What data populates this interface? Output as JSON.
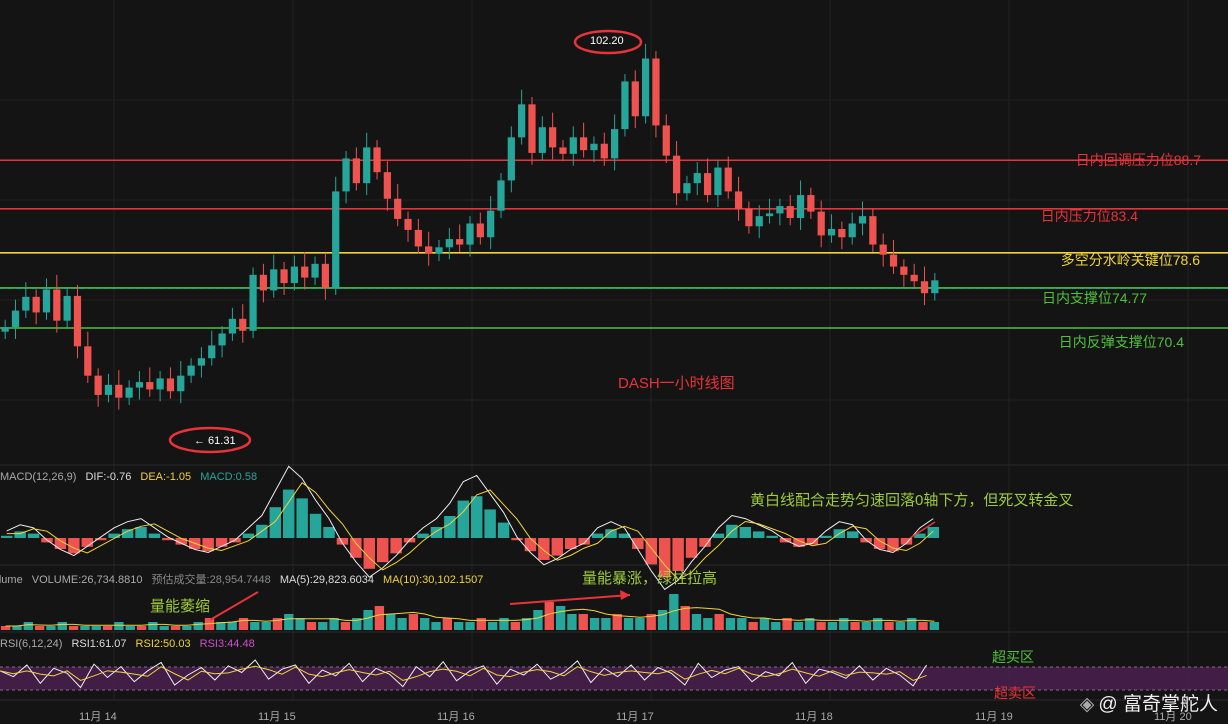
{
  "chart_data": {
    "type": "candlestick",
    "title": "DASH一小时线图",
    "x_ticks": [
      "11月 14",
      "11月 15",
      "11月 16",
      "11月 17",
      "11月 18",
      "11月 19",
      "11月 20"
    ],
    "price": {
      "high_label": "102.20",
      "low_label": "← 61.31",
      "ylim": [
        56,
        104
      ],
      "series": [
        70.5,
        72.3,
        73.8,
        72.1,
        74.6,
        71.2,
        73.9,
        68.4,
        65.2,
        63.1,
        64.2,
        62.8,
        63.9,
        64.5,
        63.7,
        64.9,
        63.5,
        65.2,
        66.3,
        67.1,
        68.5,
        69.8,
        71.4,
        70.1,
        76.2,
        74.5,
        76.8,
        75.3,
        77.1,
        75.9,
        77.4,
        74.8,
        85.3,
        88.9,
        86.2,
        90.1,
        87.4,
        84.5,
        82.3,
        81.1,
        79.3,
        78.5,
        79.2,
        80.1,
        79.5,
        81.8,
        80.3,
        83.2,
        86.5,
        91.2,
        94.8,
        89.5,
        92.3,
        90.1,
        89.4,
        91.2,
        89.8,
        90.5,
        88.9,
        92.1,
        97.3,
        93.5,
        99.8,
        92.5,
        89.2,
        85.1,
        86.2,
        87.3,
        84.9,
        87.9,
        85.3,
        83.4,
        81.5,
        82.6,
        82.9,
        83.7,
        82.4,
        84.9,
        83.1,
        80.5,
        81.2,
        80.3,
        81.8,
        82.6,
        79.5,
        78.4,
        77.1,
        76.2,
        75.5,
        74.2,
        75.6
      ]
    },
    "levels": [
      {
        "label": "日内回调压力位88.7",
        "value": 88.7,
        "color": "#e8333a"
      },
      {
        "label": "日内压力位83.4",
        "value": 83.4,
        "color": "#e8333a"
      },
      {
        "label": "多空分水岭关键位78.6",
        "value": 78.6,
        "color": "#f0d43a"
      },
      {
        "label": "日内支撑位74.77",
        "value": 74.77,
        "color": "#4fc13b"
      },
      {
        "label": "日内反弹支撑位70.4",
        "value": 70.4,
        "color": "#4fc13b"
      }
    ],
    "macd": {
      "name": "MACD(12,26,9)",
      "dif": "DIF:-0.76",
      "dea": "DEA:-1.05",
      "macd": "MACD:0.58",
      "hist": [
        0.1,
        0.3,
        0.2,
        -0.2,
        -0.5,
        -0.7,
        -0.4,
        -0.1,
        0.2,
        0.4,
        0.5,
        0.2,
        -0.1,
        -0.3,
        -0.5,
        -0.6,
        -0.4,
        -0.2,
        0.2,
        0.6,
        1.4,
        2.2,
        1.8,
        1.1,
        0.5,
        -0.3,
        -0.9,
        -1.4,
        -1.1,
        -0.7,
        -0.2,
        0.2,
        0.5,
        1.0,
        1.7,
        1.9,
        1.3,
        0.7,
        -0.1,
        -0.6,
        -1.0,
        -0.8,
        -0.5,
        -0.3,
        0.2,
        0.4,
        0.2,
        -0.5,
        -1.2,
        -1.8,
        -1.5,
        -0.9,
        -0.4,
        0.2,
        0.6,
        0.5,
        0.3,
        0.1,
        -0.2,
        -0.4,
        -0.3,
        0.1,
        0.4,
        0.3,
        -0.2,
        -0.5,
        -0.6,
        -0.3,
        0.2,
        0.5
      ]
    },
    "volume": {
      "name": "Volume",
      "volume": "VOLUME:26,734.8810",
      "forecast": "预估成交量:28,954.7448",
      "ma5": "MA(5):29,823.6034",
      "ma10": "MA(10):30,102.1507",
      "bars": [
        1,
        1,
        2,
        1,
        1,
        2,
        1,
        1,
        1,
        1,
        2,
        1,
        1,
        2,
        1,
        1,
        1,
        2,
        3,
        2,
        2,
        3,
        2,
        2,
        3,
        4,
        3,
        2,
        2,
        3,
        2,
        3,
        5,
        6,
        4,
        3,
        4,
        3,
        2,
        3,
        2,
        2,
        3,
        2,
        3,
        2,
        3,
        5,
        7,
        6,
        4,
        4,
        3,
        3,
        4,
        3,
        3,
        4,
        5,
        9,
        6,
        4,
        3,
        4,
        3,
        3,
        2,
        3,
        2,
        3,
        2,
        3,
        2,
        2,
        3,
        2,
        2,
        3,
        2,
        2,
        3,
        2,
        2
      ]
    },
    "rsi": {
      "name": "RSI(6,12,24)",
      "rsi1": "RSI1:61.07",
      "rsi2": "RSI2:50.03",
      "rsi3": "RSI3:44.48",
      "overbought_label": "超买区",
      "oversold_label": "超卖区",
      "values": [
        55,
        48,
        62,
        40,
        58,
        52,
        35,
        63,
        47,
        60,
        42,
        55,
        65,
        38,
        50,
        59,
        44,
        61,
        53,
        68,
        45,
        57,
        62,
        40,
        56,
        49,
        64,
        42,
        58,
        51,
        36,
        60,
        48,
        66,
        43,
        55,
        61,
        39,
        57,
        50,
        63,
        45,
        53,
        67,
        41,
        58,
        48,
        62,
        44,
        59,
        52,
        38,
        64,
        47,
        56,
        60,
        42,
        54,
        49,
        65,
        40,
        57,
        53,
        46,
        61,
        44,
        58,
        50,
        37,
        62
      ]
    },
    "annotations": {
      "macd_note": "黄白线配合走势匀速回落0轴下方，但死叉转金叉",
      "volume_spike": "量能暴涨，绿柱拉高",
      "volume_shrink": "量能萎缩"
    }
  },
  "watermark": "@ 富奇掌舵人"
}
